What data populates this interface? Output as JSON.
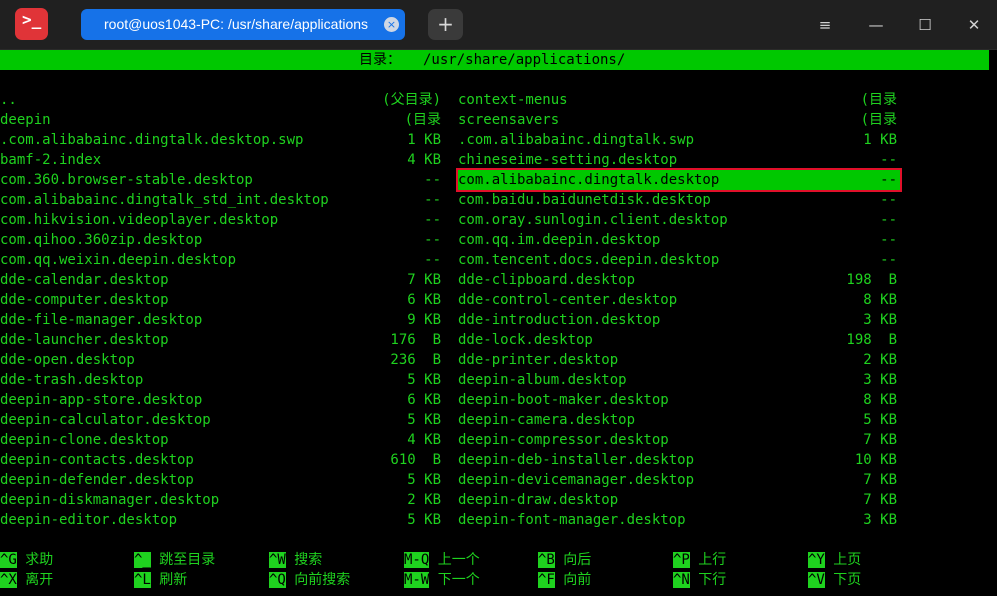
{
  "window": {
    "app_icon_glyph": ">_",
    "tab_title": "root@uos1043-PC: /usr/share/applications",
    "tab_close_glyph": "×",
    "new_tab_glyph": "+",
    "menu_glyph": "≡",
    "minimize_glyph": "—",
    "maximize_glyph": "☐",
    "close_glyph": "✕"
  },
  "browser": {
    "header_label": "目录：",
    "header_path": "/usr/share/applications/"
  },
  "left": [
    {
      "name": "..",
      "size": "(父目录)"
    },
    {
      "name": "deepin",
      "size": "(目录"
    },
    {
      "name": ".com.alibabainc.dingtalk.desktop.swp",
      "size": "1 KB"
    },
    {
      "name": "bamf-2.index",
      "size": "4 KB"
    },
    {
      "name": "com.360.browser-stable.desktop",
      "size": "--"
    },
    {
      "name": "com.alibabainc.dingtalk_std_int.desktop",
      "size": "--"
    },
    {
      "name": "com.hikvision.videoplayer.desktop",
      "size": "--"
    },
    {
      "name": "com.qihoo.360zip.desktop",
      "size": "--"
    },
    {
      "name": "com.qq.weixin.deepin.desktop",
      "size": "--"
    },
    {
      "name": "dde-calendar.desktop",
      "size": "7 KB"
    },
    {
      "name": "dde-computer.desktop",
      "size": "6 KB"
    },
    {
      "name": "dde-file-manager.desktop",
      "size": "9 KB"
    },
    {
      "name": "dde-launcher.desktop",
      "size": "176  B"
    },
    {
      "name": "dde-open.desktop",
      "size": "236  B"
    },
    {
      "name": "dde-trash.desktop",
      "size": "5 KB"
    },
    {
      "name": "deepin-app-store.desktop",
      "size": "6 KB"
    },
    {
      "name": "deepin-calculator.desktop",
      "size": "5 KB"
    },
    {
      "name": "deepin-clone.desktop",
      "size": "4 KB"
    },
    {
      "name": "deepin-contacts.desktop",
      "size": "610  B"
    },
    {
      "name": "deepin-defender.desktop",
      "size": "5 KB"
    },
    {
      "name": "deepin-diskmanager.desktop",
      "size": "2 KB"
    },
    {
      "name": "deepin-editor.desktop",
      "size": "5 KB"
    }
  ],
  "right": [
    {
      "name": "context-menus",
      "size": "(目录"
    },
    {
      "name": "screensavers",
      "size": "(目录"
    },
    {
      "name": ".com.alibabainc.dingtalk.swp",
      "size": "1 KB"
    },
    {
      "name": "chineseime-setting.desktop",
      "size": "--"
    },
    {
      "name": "com.alibabainc.dingtalk.desktop",
      "size": "--"
    },
    {
      "name": "com.baidu.baidunetdisk.desktop",
      "size": "--"
    },
    {
      "name": "com.oray.sunlogin.client.desktop",
      "size": "--"
    },
    {
      "name": "com.qq.im.deepin.desktop",
      "size": "--"
    },
    {
      "name": "com.tencent.docs.deepin.desktop",
      "size": "--"
    },
    {
      "name": "dde-clipboard.desktop",
      "size": "198  B"
    },
    {
      "name": "dde-control-center.desktop",
      "size": "8 KB"
    },
    {
      "name": "dde-introduction.desktop",
      "size": "3 KB"
    },
    {
      "name": "dde-lock.desktop",
      "size": "198  B"
    },
    {
      "name": "dde-printer.desktop",
      "size": "2 KB"
    },
    {
      "name": "deepin-album.desktop",
      "size": "3 KB"
    },
    {
      "name": "deepin-boot-maker.desktop",
      "size": "8 KB"
    },
    {
      "name": "deepin-camera.desktop",
      "size": "5 KB"
    },
    {
      "name": "deepin-compressor.desktop",
      "size": "7 KB"
    },
    {
      "name": "deepin-deb-installer.desktop",
      "size": "10 KB"
    },
    {
      "name": "deepin-devicemanager.desktop",
      "size": "7 KB"
    },
    {
      "name": "deepin-draw.desktop",
      "size": "7 KB"
    },
    {
      "name": "deepin-font-manager.desktop",
      "size": "3 KB"
    }
  ],
  "selected": "com.alibabainc.dingtalk.desktop",
  "help": [
    [
      {
        "key": "^G",
        "desc": "求助"
      },
      {
        "key": "^X",
        "desc": "离开"
      }
    ],
    [
      {
        "key": "^_",
        "desc": "跳至目录"
      },
      {
        "key": "^L",
        "desc": "刷新"
      }
    ],
    [
      {
        "key": "^W",
        "desc": "搜索"
      },
      {
        "key": "^Q",
        "desc": "向前搜索"
      }
    ],
    [
      {
        "key": "M-Q",
        "desc": "上一个"
      },
      {
        "key": "M-W",
        "desc": "下一个"
      }
    ],
    [
      {
        "key": "^B",
        "desc": "向后"
      },
      {
        "key": "^F",
        "desc": "向前"
      }
    ],
    [
      {
        "key": "^P",
        "desc": "上行"
      },
      {
        "key": "^N",
        "desc": "下行"
      }
    ],
    [
      {
        "key": "^Y",
        "desc": "上页"
      },
      {
        "key": "^V",
        "desc": "下页"
      }
    ]
  ],
  "colors": {
    "terminal_bg": "#000000",
    "terminal_text": "#1fd21f",
    "highlight_bg": "#00c800",
    "selection_outline": "#e0102a",
    "tab_active": "#1672e8",
    "titlebar_bg": "#202020"
  },
  "icons": {
    "app": "terminal-icon",
    "tab_close": "close-circle-icon",
    "new_tab": "plus-icon",
    "menu": "hamburger-menu-icon",
    "minimize": "minimize-icon",
    "maximize": "maximize-icon",
    "close": "close-icon"
  }
}
